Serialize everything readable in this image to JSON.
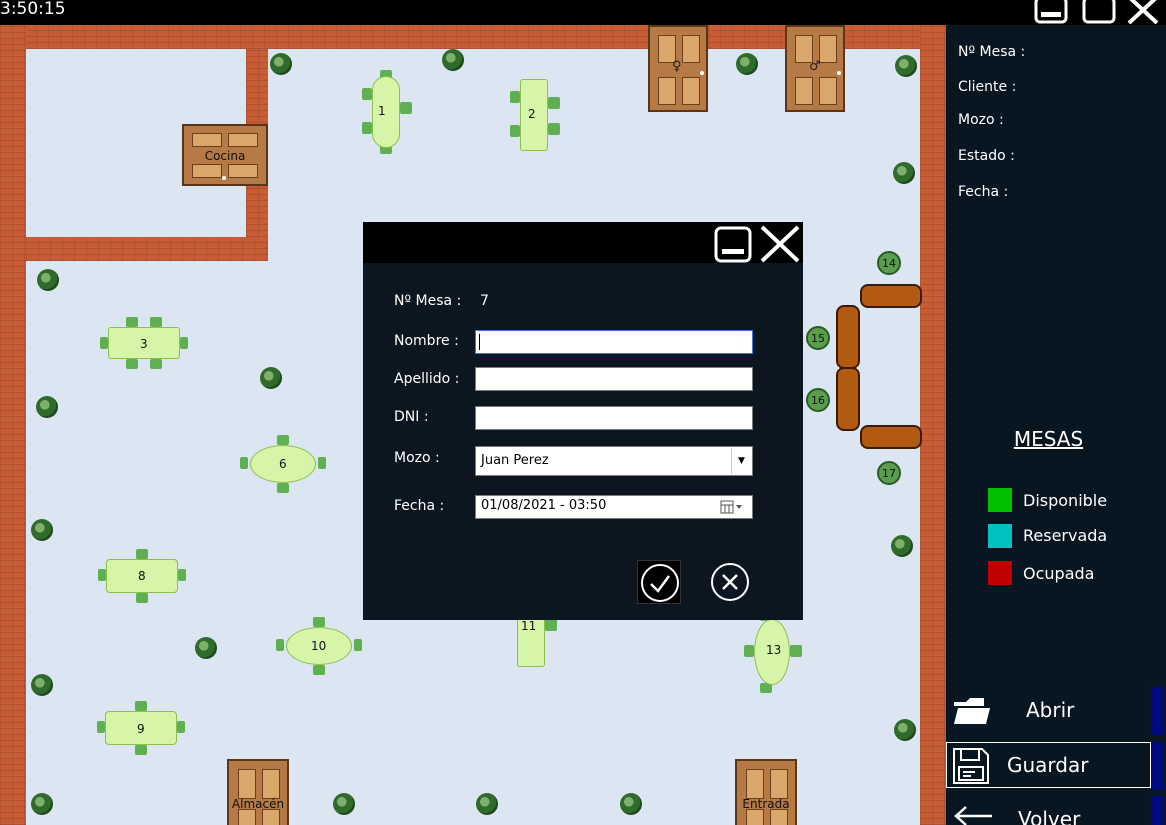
{
  "clock": "3:50:15",
  "floor": {
    "doors": {
      "kitchen": "Cocina",
      "storage": "Almacén",
      "entrance": "Entrada",
      "restroom_female": "♀",
      "restroom_male": "♂"
    },
    "tables": [
      "1",
      "2",
      "3",
      "6",
      "8",
      "9",
      "10",
      "11",
      "13"
    ],
    "bar_seats": [
      "14",
      "15",
      "16",
      "17"
    ]
  },
  "panel": {
    "info_labels": {
      "mesa": "Nº Mesa :",
      "cliente": "Cliente :",
      "mozo": "Mozo :",
      "estado": "Estado :",
      "fecha": "Fecha :"
    },
    "legend_title": "MESAS",
    "legend": [
      {
        "label": "Disponible",
        "color": "#00c000"
      },
      {
        "label": "Reservada",
        "color": "#00c0c0"
      },
      {
        "label": "Ocupada",
        "color": "#c00000"
      }
    ],
    "buttons": {
      "open": "Abrir",
      "save": "Guardar",
      "back": "Volver"
    }
  },
  "dialog": {
    "mesa_label": "Nº Mesa :",
    "mesa_value": "7",
    "nombre_label": "Nombre :",
    "nombre_value": "",
    "apellido_label": "Apellido :",
    "apellido_value": "",
    "dni_label": "DNI :",
    "dni_value": "",
    "mozo_label": "Mozo :",
    "mozo_value": "Juan Perez",
    "fecha_label": "Fecha :",
    "fecha_value": "01/08/2021 - 03:50"
  },
  "colors": {
    "panel_bg": "#081622",
    "dialog_bg": "#0b1620",
    "floor_bg": "#dbe6f2",
    "brick": "#c85d35",
    "table": "#d6f5a8",
    "bench": "#b35a12",
    "navy_accent": "#000a80"
  }
}
